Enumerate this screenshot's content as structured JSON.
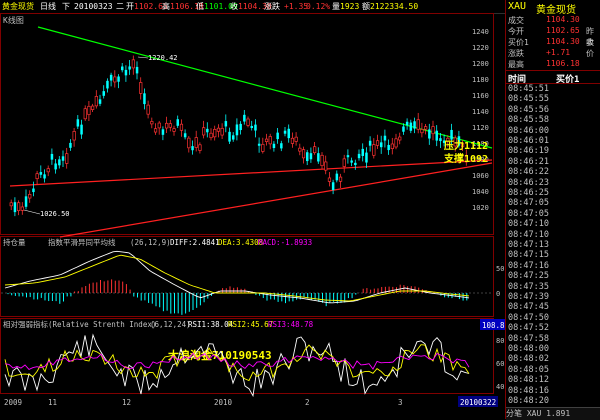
{
  "topbar": {
    "name": "黄金现货",
    "period": "日线",
    "day": "下",
    "date": "20100323",
    "weekday": "二",
    "open_label": "开",
    "open": "1102.65",
    "high_label": "高",
    "high": "1106.18",
    "low_label": "低",
    "low": "1101.09",
    "close_label": "收",
    "close": "1104.30",
    "change_label": "涨跌",
    "change": "+1.35",
    "pct": "0.12%",
    "vol_label": "量",
    "vol": "1923",
    "amount_label": "额",
    "amount": "2122334.50"
  },
  "main_chart": {
    "label": "K线图",
    "yticks": [
      "1240",
      "1220",
      "1200",
      "1180",
      "1160",
      "1140",
      "1120",
      "1100",
      "1080",
      "1060",
      "1040",
      "1020"
    ],
    "high_annotation": "1220.42",
    "low_annotation": "1026.50",
    "resistance_text": "压力1112",
    "support_text": "支撑1092"
  },
  "macd_panel": {
    "title": "持仓量",
    "indicator": "指数平滑异同平均线",
    "params": "(26,12,9)",
    "diff": "DIFF:2.4841",
    "dea": "DEA:3.4308",
    "macd": "MACD:-1.8933",
    "yticks": [
      "50",
      "0"
    ]
  },
  "rsi_panel": {
    "title": "相对强弱指标(Relative Strenth Index)",
    "params": "(6,12,24)",
    "rsi1": "RSI1:38.04",
    "rsi2": "RSI2:45.67",
    "rsi3": "RSI3:48.78",
    "value_box": "108.85",
    "watermark": "大浪淘金710190543",
    "yticks": [
      "80",
      "60",
      "40"
    ]
  },
  "xaxis": {
    "labels": [
      "2009",
      "11",
      "12",
      "2010",
      "2",
      "3"
    ],
    "current_date": "20100322"
  },
  "side": {
    "symbol": "XAU",
    "name": "黄金现货",
    "quote": [
      {
        "label": "成交",
        "value": "1104.30"
      },
      {
        "label": "今开",
        "value": "1102.65"
      },
      {
        "label": "买价1",
        "value": "1104.30"
      },
      {
        "label": "涨跌",
        "value": "+1.71"
      },
      {
        "label": "最高",
        "value": "1106.18"
      }
    ],
    "right_labels": [
      "昨收",
      "卖价"
    ],
    "col_time": "时间",
    "col_buy": "买价1",
    "times": [
      "08:45:51",
      "08:45:55",
      "08:45:56",
      "08:45:58",
      "08:46:00",
      "08:46:01",
      "08:46:19",
      "08:46:21",
      "08:46:22",
      "08:46:23",
      "08:46:25",
      "08:47:05",
      "08:47:05",
      "08:47:10",
      "08:47:10",
      "08:47:13",
      "08:47:15",
      "08:47:16",
      "08:47:25",
      "08:47:35",
      "08:47:39",
      "08:47:45",
      "08:47:50",
      "08:47:52",
      "08:47:58",
      "08:48:00",
      "08:48:02",
      "08:48:05",
      "08:48:12",
      "08:48:16",
      "08:48:20"
    ],
    "footer": "分笔 XAU 1.891"
  },
  "colors": {
    "up": "#ff3232",
    "down": "#00ffff",
    "resistance": "#00ff00",
    "support": "#ff0000",
    "macd_pos": "#ff3232",
    "macd_neg": "#00ffff"
  }
}
